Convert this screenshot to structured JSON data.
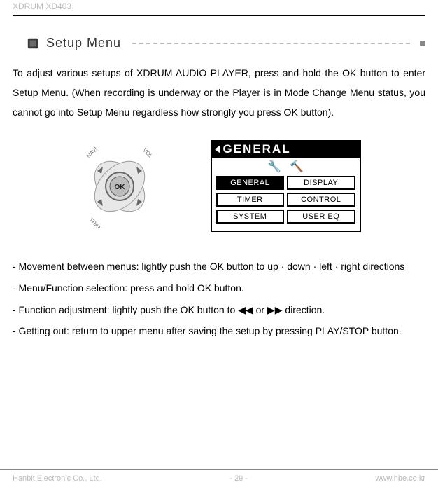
{
  "header": {
    "product": "XDRUM XD403"
  },
  "section": {
    "title": "Setup Menu"
  },
  "intro": "To adjust various setups of XDRUM AUDIO PLAYER, press and hold the OK button to enter Setup Menu. (When recording is underway or the Player is in Mode Change Menu status, you cannot go into Setup Menu regardless how strongly you press OK button).",
  "ok_control": {
    "center": "OK",
    "labels": {
      "nw": "NAVI",
      "ne": "VOL",
      "sw": "TRANS",
      "se": ""
    }
  },
  "device_screen": {
    "title": "GENERAL",
    "items": [
      "GENERAL",
      "DISPLAY",
      "TIMER",
      "CONTROL",
      "SYSTEM",
      "USER EQ"
    ],
    "active_index": 0
  },
  "bullets": {
    "b1": "- Movement between menus: lightly push the OK button to up · down · left · right directions",
    "b2": "- Menu/Function selection: press and hold OK button.",
    "b3_pre": "- Function adjustment: lightly push the OK button to ",
    "b3_mid": " or ",
    "b3_post": " direction.",
    "b4": "- Getting out: return to upper menu after saving the setup by pressing PLAY/STOP button."
  },
  "symbols": {
    "rewind": "◀◀",
    "forward": "▶▶"
  },
  "footer": {
    "left": "Hanbit Electronic Co., Ltd.",
    "center": "- 29 -",
    "right": "www.hbe.co.kr"
  }
}
